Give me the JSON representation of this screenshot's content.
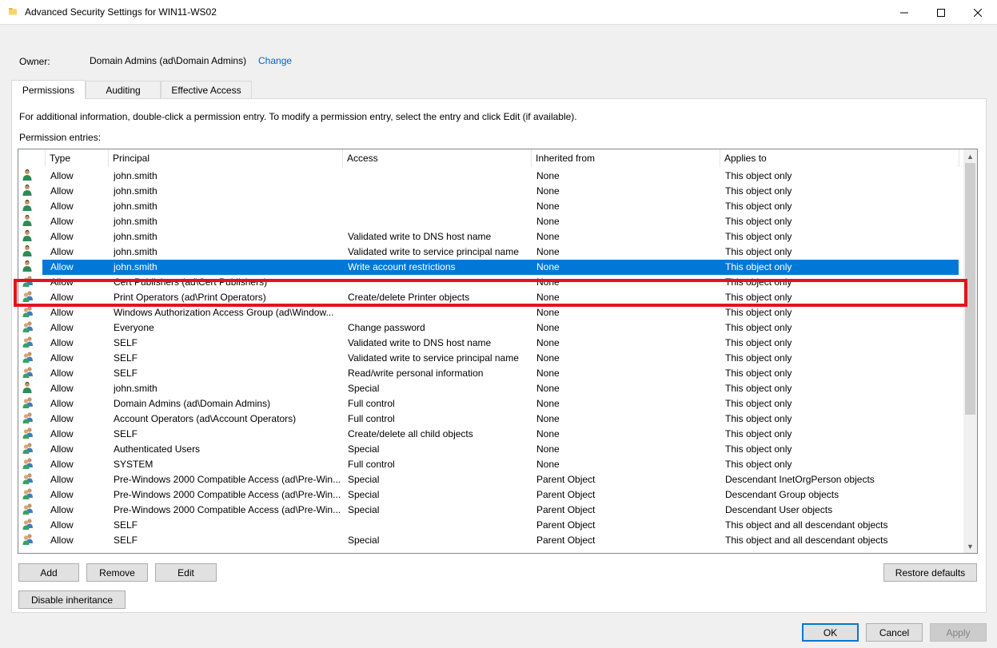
{
  "window": {
    "title": "Advanced Security Settings for WIN11-WS02",
    "minimize_icon": "minimize-icon",
    "maximize_icon": "maximize-icon",
    "close_icon": "close-icon"
  },
  "owner": {
    "label": "Owner:",
    "value": "Domain Admins (ad\\Domain Admins)",
    "change_link": "Change"
  },
  "tabs": [
    {
      "label": "Permissions",
      "active": true
    },
    {
      "label": "Auditing",
      "active": false
    },
    {
      "label": "Effective Access",
      "active": false
    }
  ],
  "info_text": "For additional information, double-click a permission entry. To modify a permission entry, select the entry and click Edit (if available).",
  "entries_label": "Permission entries:",
  "columns": {
    "type": "Type",
    "principal": "Principal",
    "access": "Access",
    "inherited": "Inherited from",
    "applies": "Applies to"
  },
  "entries": [
    {
      "icon": "user",
      "type": "Allow",
      "principal": "john.smith",
      "access": "",
      "inherited": "None",
      "applies": "This object only"
    },
    {
      "icon": "user",
      "type": "Allow",
      "principal": "john.smith",
      "access": "",
      "inherited": "None",
      "applies": "This object only"
    },
    {
      "icon": "user",
      "type": "Allow",
      "principal": "john.smith",
      "access": "",
      "inherited": "None",
      "applies": "This object only"
    },
    {
      "icon": "user",
      "type": "Allow",
      "principal": "john.smith",
      "access": "",
      "inherited": "None",
      "applies": "This object only"
    },
    {
      "icon": "user",
      "type": "Allow",
      "principal": "john.smith",
      "access": "Validated write to DNS host name",
      "inherited": "None",
      "applies": "This object only"
    },
    {
      "icon": "user",
      "type": "Allow",
      "principal": "john.smith",
      "access": "Validated write to service principal name",
      "inherited": "None",
      "applies": "This object only"
    },
    {
      "icon": "user",
      "type": "Allow",
      "principal": "john.smith",
      "access": "Write account restrictions",
      "inherited": "None",
      "applies": "This object only",
      "selected": true
    },
    {
      "icon": "group",
      "type": "Allow",
      "principal": "Cert Publishers (ad\\Cert Publishers)",
      "access": "",
      "inherited": "None",
      "applies": "This object only"
    },
    {
      "icon": "group",
      "type": "Allow",
      "principal": "Print Operators (ad\\Print Operators)",
      "access": "Create/delete Printer objects",
      "inherited": "None",
      "applies": "This object only"
    },
    {
      "icon": "group",
      "type": "Allow",
      "principal": "Windows Authorization Access Group (ad\\Window...",
      "access": "",
      "inherited": "None",
      "applies": "This object only"
    },
    {
      "icon": "group",
      "type": "Allow",
      "principal": "Everyone",
      "access": "Change password",
      "inherited": "None",
      "applies": "This object only"
    },
    {
      "icon": "group",
      "type": "Allow",
      "principal": "SELF",
      "access": "Validated write to DNS host name",
      "inherited": "None",
      "applies": "This object only"
    },
    {
      "icon": "group",
      "type": "Allow",
      "principal": "SELF",
      "access": "Validated write to service principal name",
      "inherited": "None",
      "applies": "This object only"
    },
    {
      "icon": "group",
      "type": "Allow",
      "principal": "SELF",
      "access": "Read/write personal information",
      "inherited": "None",
      "applies": "This object only"
    },
    {
      "icon": "user",
      "type": "Allow",
      "principal": "john.smith",
      "access": "Special",
      "inherited": "None",
      "applies": "This object only"
    },
    {
      "icon": "group",
      "type": "Allow",
      "principal": "Domain Admins (ad\\Domain Admins)",
      "access": "Full control",
      "inherited": "None",
      "applies": "This object only"
    },
    {
      "icon": "group",
      "type": "Allow",
      "principal": "Account Operators (ad\\Account Operators)",
      "access": "Full control",
      "inherited": "None",
      "applies": "This object only"
    },
    {
      "icon": "group",
      "type": "Allow",
      "principal": "SELF",
      "access": "Create/delete all child objects",
      "inherited": "None",
      "applies": "This object only"
    },
    {
      "icon": "group",
      "type": "Allow",
      "principal": "Authenticated Users",
      "access": "Special",
      "inherited": "None",
      "applies": "This object only"
    },
    {
      "icon": "group",
      "type": "Allow",
      "principal": "SYSTEM",
      "access": "Full control",
      "inherited": "None",
      "applies": "This object only"
    },
    {
      "icon": "group",
      "type": "Allow",
      "principal": "Pre-Windows 2000 Compatible Access (ad\\Pre-Win...",
      "access": "Special",
      "inherited": "Parent Object",
      "applies": "Descendant InetOrgPerson objects"
    },
    {
      "icon": "group",
      "type": "Allow",
      "principal": "Pre-Windows 2000 Compatible Access (ad\\Pre-Win...",
      "access": "Special",
      "inherited": "Parent Object",
      "applies": "Descendant Group objects"
    },
    {
      "icon": "group",
      "type": "Allow",
      "principal": "Pre-Windows 2000 Compatible Access (ad\\Pre-Win...",
      "access": "Special",
      "inherited": "Parent Object",
      "applies": "Descendant User objects"
    },
    {
      "icon": "group",
      "type": "Allow",
      "principal": "SELF",
      "access": "",
      "inherited": "Parent Object",
      "applies": "This object and all descendant objects"
    },
    {
      "icon": "group",
      "type": "Allow",
      "principal": "SELF",
      "access": "Special",
      "inherited": "Parent Object",
      "applies": "This object and all descendant objects"
    }
  ],
  "buttons": {
    "add": "Add",
    "remove": "Remove",
    "edit": "Edit",
    "restore_defaults": "Restore defaults",
    "disable_inheritance": "Disable inheritance",
    "ok": "OK",
    "cancel": "Cancel",
    "apply": "Apply"
  },
  "colors": {
    "selection": "#0078d7",
    "highlight_box": "#e1141e",
    "link": "#0066cc"
  }
}
